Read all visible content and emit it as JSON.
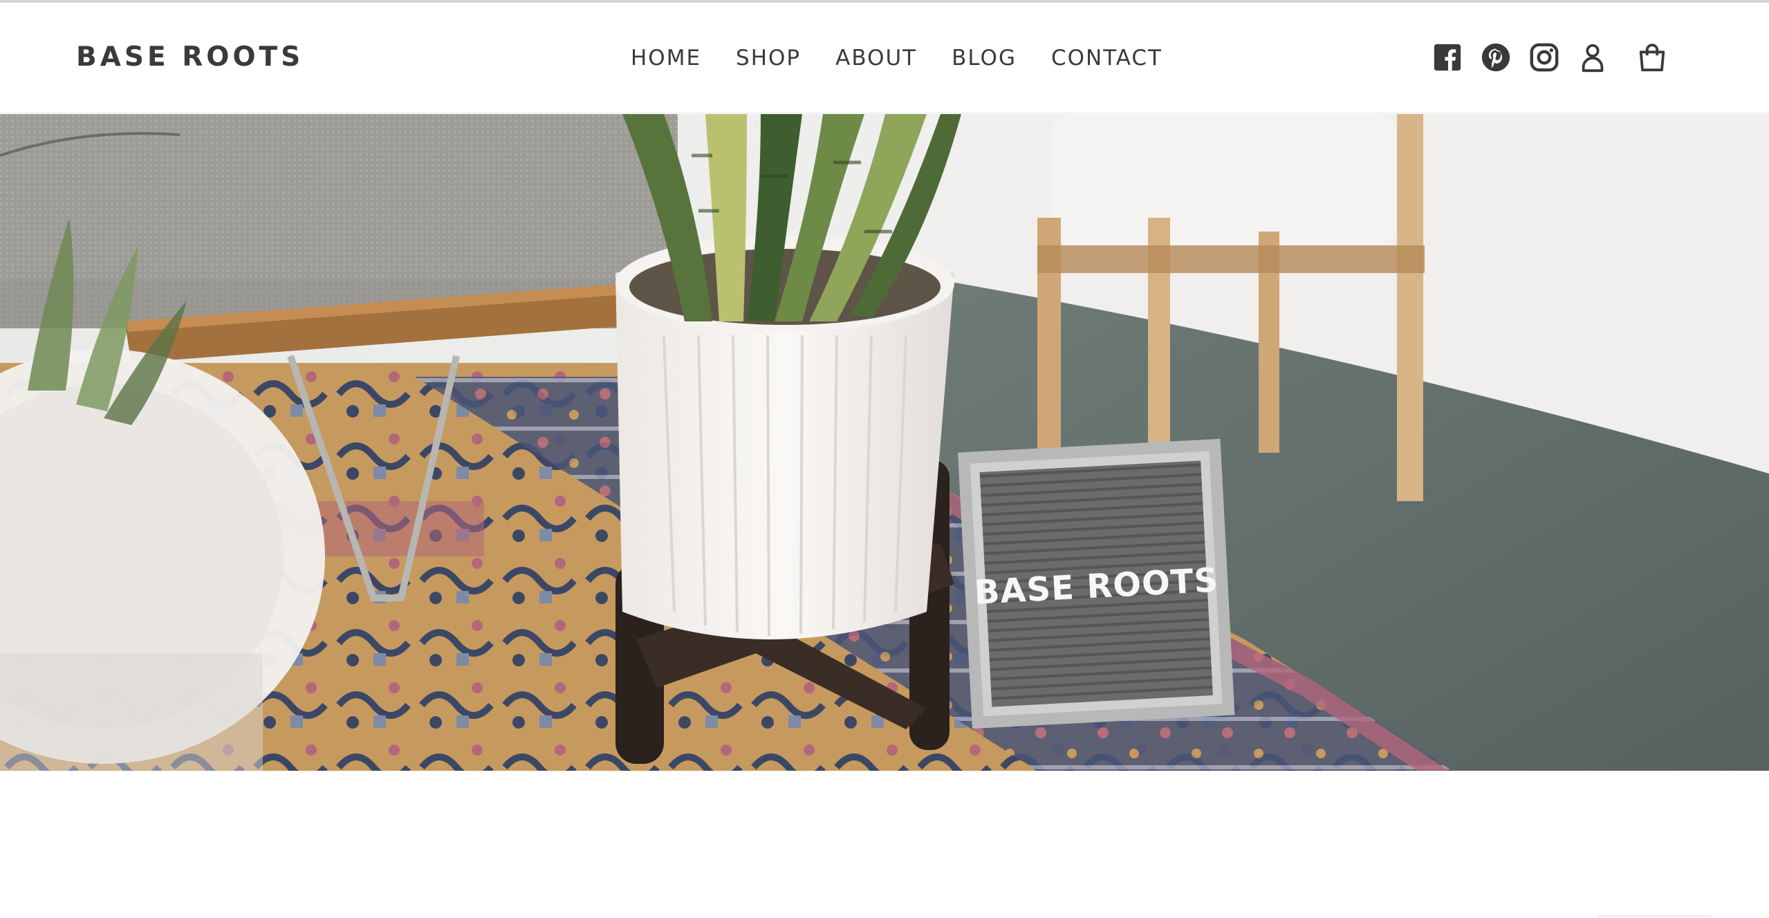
{
  "brand": {
    "name": "BASE ROOTS"
  },
  "nav": {
    "items": [
      {
        "label": "HOME"
      },
      {
        "label": "SHOP"
      },
      {
        "label": "ABOUT"
      },
      {
        "label": "BLOG"
      },
      {
        "label": "CONTACT"
      }
    ]
  },
  "header_icons": [
    {
      "name": "facebook-icon"
    },
    {
      "name": "pinterest-icon"
    },
    {
      "name": "instagram-icon"
    },
    {
      "name": "account-icon"
    },
    {
      "name": "cart-icon"
    }
  ],
  "hero": {
    "letterboard_text": "BASE  ROOTS"
  },
  "colors": {
    "text": "#3a3a3a",
    "background": "#ffffff",
    "floor": "#5d6a66",
    "rug_gold": "#c89a5a",
    "rug_navy": "#3c4766",
    "rug_pink": "#b3677a"
  }
}
